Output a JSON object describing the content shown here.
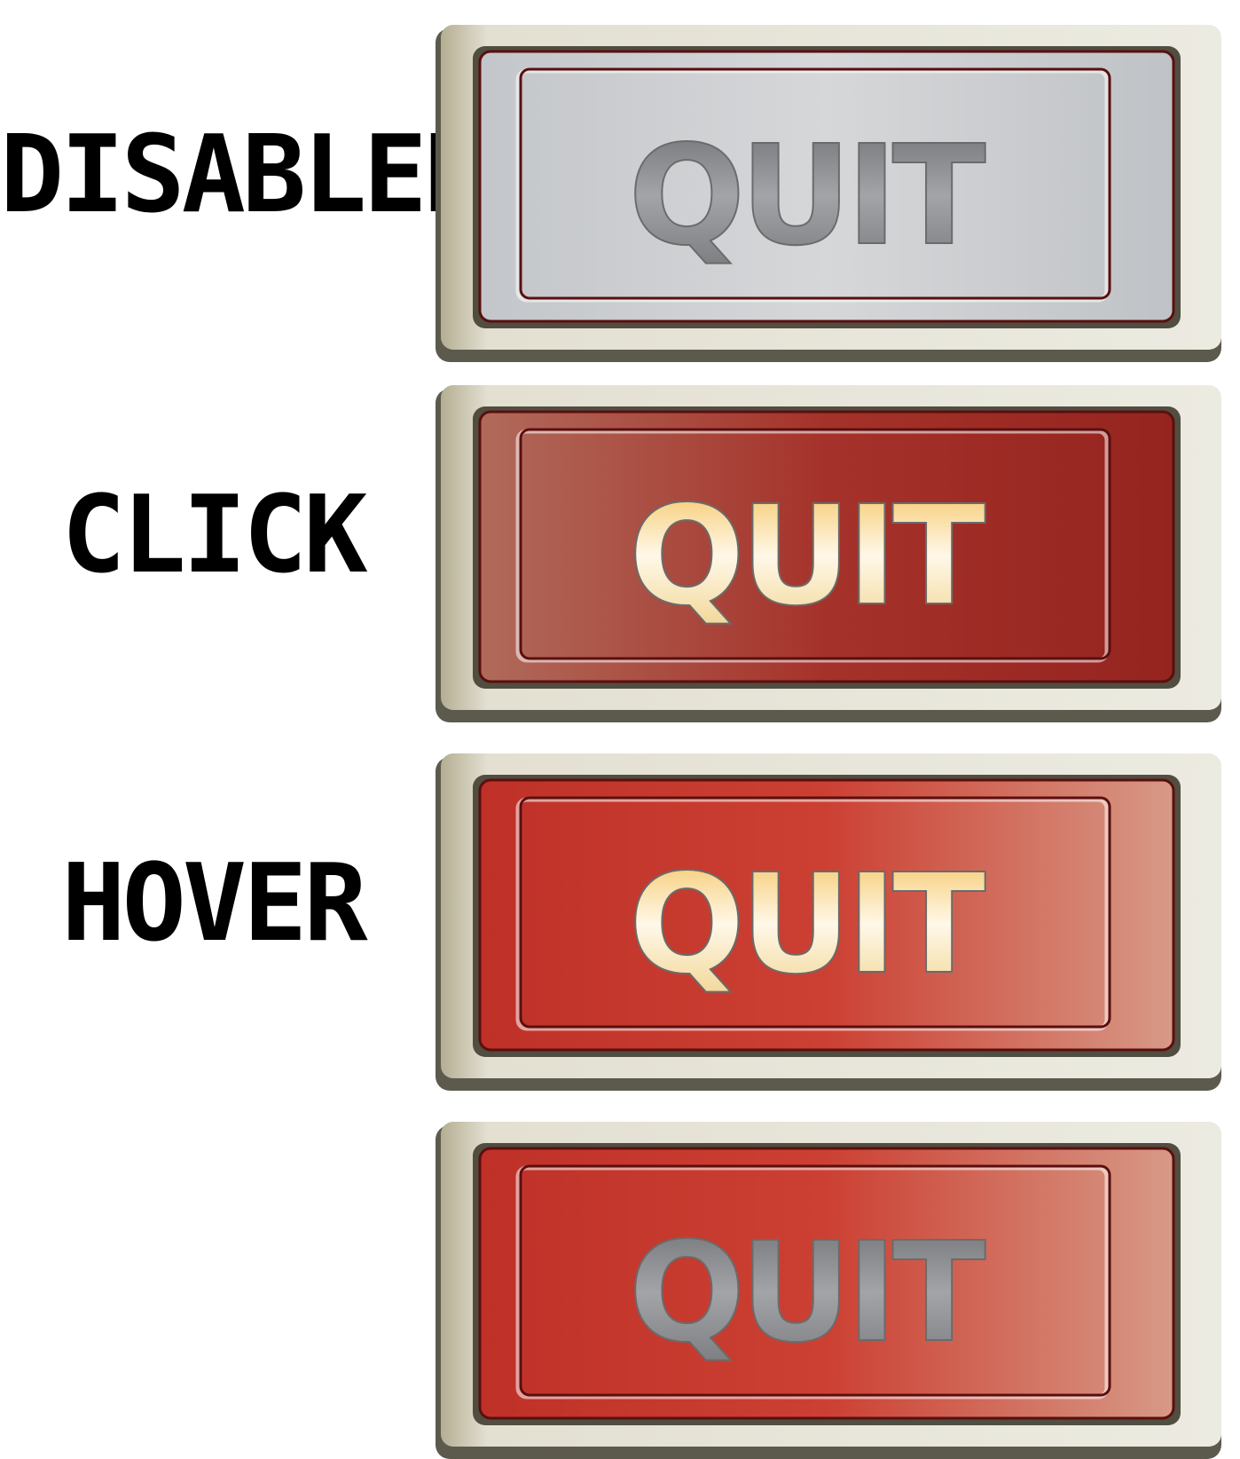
{
  "buttons": [
    {
      "state_label": "DISABLED",
      "text": "QUIT",
      "face_stops": [
        "#c3c6ca",
        "#d6d7d9",
        "#bfc2c6"
      ],
      "text_stops": [
        "#6d6f73",
        "#a2a4a8",
        "#77797c"
      ],
      "interactable": false
    },
    {
      "state_label": "CLICK",
      "text": "QUIT",
      "face_stops": [
        "#b06a5a",
        "#a5322a",
        "#95241f"
      ],
      "text_stops": [
        "#f4c15a",
        "#fff8e8",
        "#f0d28c"
      ],
      "interactable": true
    },
    {
      "state_label": "HOVER",
      "text": "QUIT",
      "face_stops": [
        "#bf3128",
        "#cc4033",
        "#d79986"
      ],
      "text_stops": [
        "#f4c15a",
        "#fff8e8",
        "#f0d28c"
      ],
      "interactable": true
    },
    {
      "state_label": "",
      "text": "QUIT",
      "face_stops": [
        "#bf3128",
        "#cc4033",
        "#d79986"
      ],
      "text_stops": [
        "#6d6f73",
        "#a2a4a8",
        "#77797c"
      ],
      "interactable": true
    }
  ]
}
